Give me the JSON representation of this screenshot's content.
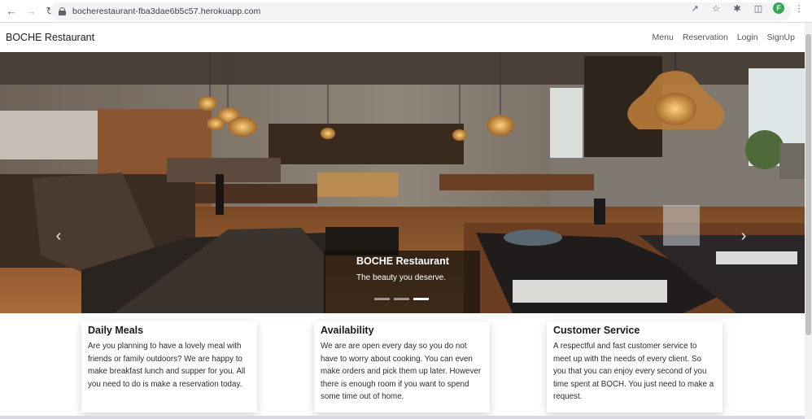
{
  "browser": {
    "url": "bocherestaurant-fba3dae6b5c57.herokuapp.com",
    "profile_initial": "F"
  },
  "navbar": {
    "brand": "BOCHE Restaurant",
    "links": [
      "Menu",
      "Reservation",
      "Login",
      "SignUp"
    ]
  },
  "hero": {
    "caption_title": "BOCHE Restaurant",
    "caption_text": "The beauty you deserve.",
    "slide_count": 3,
    "active_slide": 3
  },
  "cards": [
    {
      "title": "Daily Meals",
      "text": "Are you planning to have a lovely meal with friends or family outdoors? We are happy to make breakfast lunch and supper for you. All you need to do is make a reservation today."
    },
    {
      "title": "Availability",
      "text": "We are are open every day so you do not have to worry about cooking. You can even make orders and pick them up later. However there is enough room if you want to spend some time out of home."
    },
    {
      "title": "Customer Service",
      "text": "A respectful and fast customer service to meet up with the needs of every client. So you that you can enjoy every second of you time spent at BOCH. You just need to make a request."
    }
  ],
  "colors": {
    "caption_bg": "#14100c",
    "wood": "#8a5530",
    "profile": "#34a853"
  }
}
